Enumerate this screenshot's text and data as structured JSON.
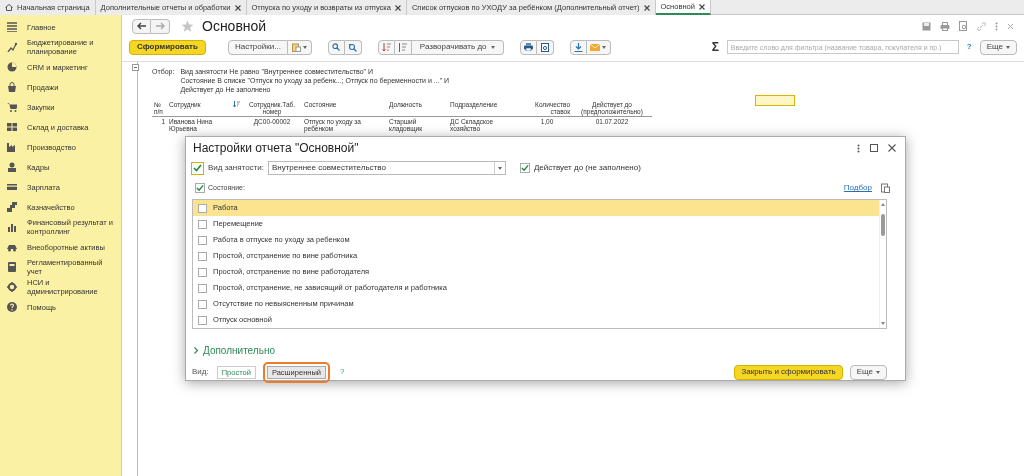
{
  "tabs": [
    {
      "label": "Начальная страница",
      "kind": "home",
      "selected": false
    },
    {
      "label": "Дополнительные отчеты и обработки",
      "kind": "tab",
      "selected": false
    },
    {
      "label": "Отпуска по уходу и возвраты из отпуска",
      "kind": "tab",
      "selected": false
    },
    {
      "label": "Список отпусков по УХОДУ за ребёнком (Дополнительный отчет)",
      "kind": "tab",
      "selected": false
    },
    {
      "label": "Основной",
      "kind": "tab",
      "selected": true
    }
  ],
  "sidebar": {
    "items": [
      {
        "label": "Главное"
      },
      {
        "label": "Бюджетирование и планирование"
      },
      {
        "label": "CRM и маркетинг"
      },
      {
        "label": "Продажи"
      },
      {
        "label": "Закупки"
      },
      {
        "label": "Склад и доставка"
      },
      {
        "label": "Производство"
      },
      {
        "label": "Кадры"
      },
      {
        "label": "Зарплата"
      },
      {
        "label": "Казначейство"
      },
      {
        "label": "Финансовый результат и контроллинг"
      },
      {
        "label": "Внеоборотные активы"
      },
      {
        "label": "Регламентированный учет"
      },
      {
        "label": "НСИ и администрирование"
      },
      {
        "label": "Помощь"
      }
    ]
  },
  "form": {
    "title": "Основной",
    "toolbar": {
      "generate": "Сформировать",
      "settings": "Настройки...",
      "expand": "Разворачивать до",
      "sum": "Σ",
      "filter_placeholder": "Введите слово для фильтра (название товара, покупателя и пр.)",
      "help": "?",
      "more": "Еще"
    }
  },
  "report": {
    "filter_label": "Отбор:",
    "filter_lines": [
      "Вид занятости Не равно \"Внутреннее совместительство\" И",
      "Состояние В списке \"Отпуск по уходу за ребенк...; Отпуск по беременности и ...\" И",
      "Действует до Не заполнено"
    ],
    "table": {
      "columns": [
        "№ п/п",
        "Сотрудник",
        "Сотрудник.Таб. номер",
        "Состояние",
        "Должность",
        "Подразделение",
        "Количество ставок",
        "Действует до (предположительно)"
      ],
      "rows": [
        [
          "1",
          "Иванова Нина Юрьевна",
          "ДС00-00002",
          "Отпуск по уходу за ребенком",
          "Старший кладовщик",
          "ДС Складское хозяйство",
          "1,00",
          "01.07.2022"
        ]
      ]
    }
  },
  "dialog": {
    "title": "Настройки отчета \"Основной\"",
    "employment": {
      "checked": true,
      "label": "Вид занятости:",
      "value": "Внутреннее совместительство"
    },
    "valid_until": {
      "checked": true,
      "label": "Действует до (не заполнено)"
    },
    "state": {
      "checked": true,
      "label": "Состояние:",
      "pick_link": "Подбор"
    },
    "states": [
      {
        "label": "Работа",
        "checked": false,
        "selected": true
      },
      {
        "label": "Перемещение",
        "checked": false,
        "selected": false
      },
      {
        "label": "Работа в отпуске по уходу за ребенком",
        "checked": false,
        "selected": false
      },
      {
        "label": "Простой, отстранение по вине работника",
        "checked": false,
        "selected": false
      },
      {
        "label": "Простой, отстранение по вине работодателя",
        "checked": false,
        "selected": false
      },
      {
        "label": "Простой, отстранение, не зависящий от работодателя и работника",
        "checked": false,
        "selected": false
      },
      {
        "label": "Отсутствие по невыясненным причинам",
        "checked": false,
        "selected": false
      },
      {
        "label": "Отпуск основной",
        "checked": false,
        "selected": false
      }
    ],
    "more_section": {
      "label": "Дополнительно",
      "expanded": false
    },
    "view_label": "Вид:",
    "views": [
      {
        "label": "Простой",
        "selected": false
      },
      {
        "label": "Расширенный",
        "selected": true
      }
    ],
    "view_help": "?",
    "close_generate": "Закрыть и сформировать",
    "more": "Еще"
  }
}
